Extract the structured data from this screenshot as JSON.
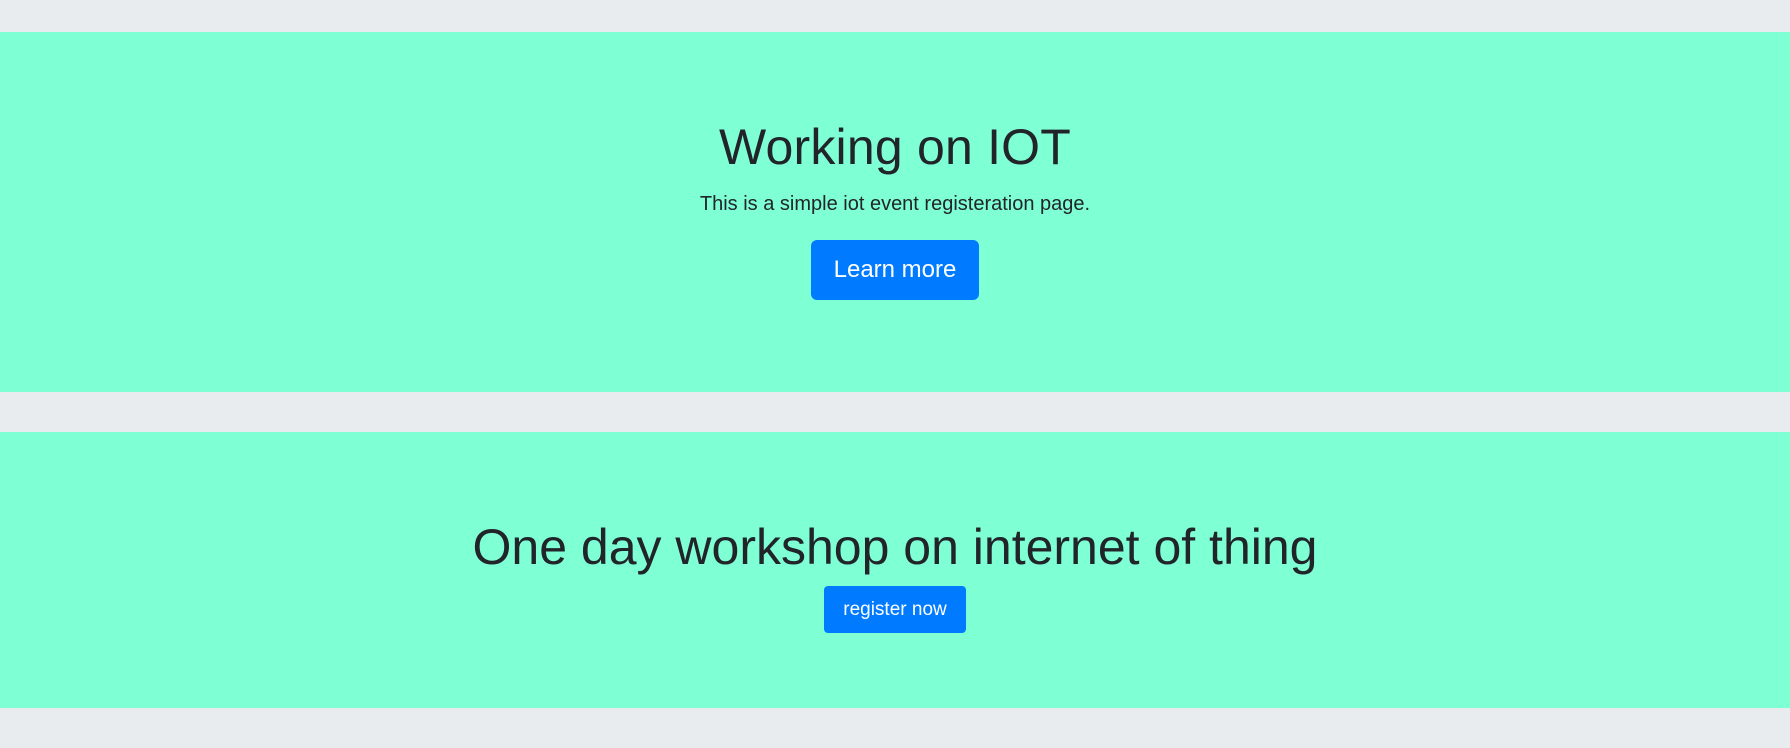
{
  "colors": {
    "page_background": "#e9ecef",
    "section_background": "#7fffd4",
    "button_background": "#007bff",
    "button_text": "#ffffff",
    "heading_text": "#212529"
  },
  "hero": {
    "title": "Working on IOT",
    "lead": "This is a simple iot event registeration page.",
    "cta_label": "Learn more"
  },
  "workshop": {
    "title": "One day workshop on internet of thing",
    "cta_label": "register now"
  }
}
